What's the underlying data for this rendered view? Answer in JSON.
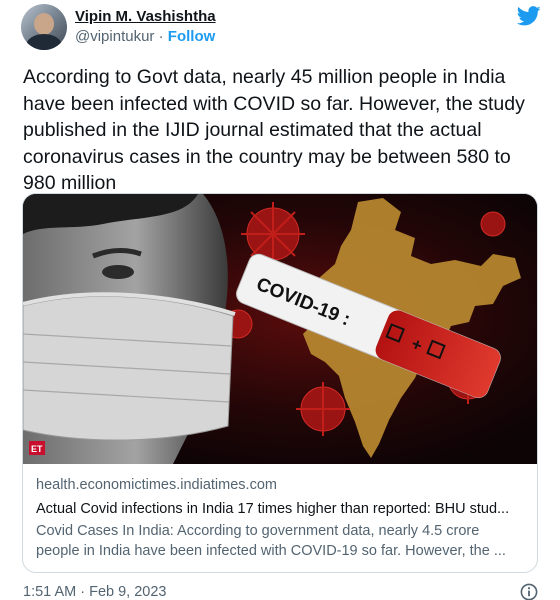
{
  "author": {
    "display_name": "Vipin M. Vashishtha",
    "handle": "@vipintukur",
    "separator": "·",
    "follow_label": "Follow",
    "avatar_icon": "user-avatar-photo"
  },
  "brand": {
    "icon": "twitter-bird-icon",
    "color": "#1d9bf0"
  },
  "tweet": {
    "text": "According to Govt data, nearly 45 million people in India have been infected with COVID so far. However, the study published in the IJID journal estimated that the actual coronavirus cases in the country may be between 580 to 980 million",
    "timestamp": "1:51 AM · Feb 9, 2023"
  },
  "card": {
    "image_caption_mark": "ET",
    "image_test_label": "COVID-19 :",
    "domain": "health.economictimes.indiatimes.com",
    "title": "Actual Covid infections in India 17 times higher than reported: BHU stud...",
    "description": "Covid Cases In India: According to government data, nearly 4.5 crore people in India have been infected with COVID-19 so far. However, the ..."
  },
  "footer": {
    "info_icon": "info-icon"
  },
  "colors": {
    "link": "#1d9bf0",
    "muted_text": "#536471",
    "border": "#cfd9de",
    "text": "#0f1419"
  }
}
